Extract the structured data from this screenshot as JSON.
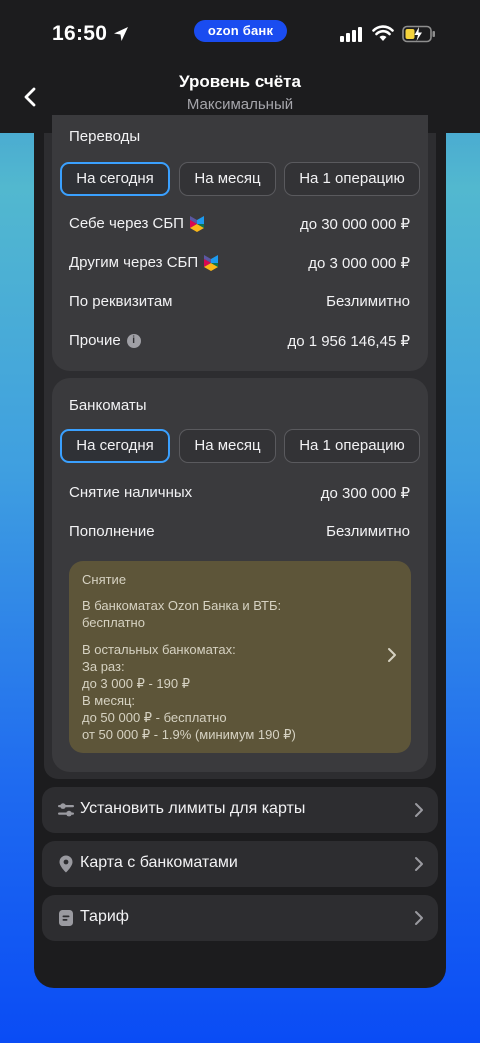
{
  "status_bar": {
    "time": "16:50",
    "app_pill": "ozon банк"
  },
  "nav": {
    "title": "Уровень счёта",
    "subtitle": "Максимальный"
  },
  "transfers": {
    "title": "Переводы",
    "tabs": [
      "На сегодня",
      "На месяц",
      "На 1 операцию"
    ],
    "active_tab": 0,
    "rows": [
      {
        "label": "Себе через СБП",
        "value": "до 30 000 000 ₽",
        "icon": "sbp-icon"
      },
      {
        "label": "Другим через СБП",
        "value": "до 3 000 000 ₽",
        "icon": "sbp-icon"
      },
      {
        "label": "По реквизитам",
        "value": "Безлимитно"
      },
      {
        "label": "Прочие",
        "value": "до 1 956 146,45 ₽",
        "icon": "info-icon"
      }
    ]
  },
  "atms": {
    "title": "Банкоматы",
    "tabs": [
      "На сегодня",
      "На месяц",
      "На 1 операцию"
    ],
    "active_tab": 0,
    "rows": [
      {
        "label": "Снятие наличных",
        "value": "до 300 000 ₽"
      },
      {
        "label": "Пополнение",
        "value": "Безлимитно"
      }
    ],
    "note": {
      "heading": "Снятие",
      "line1": "В банкоматах Ozon Банка и ВТБ:",
      "line2": "бесплатно",
      "line3": "В остальных банкоматах:",
      "line4": "За раз:",
      "line5": "до 3 000 ₽ - 190 ₽",
      "line6": "В месяц:",
      "line7": "до 50 000 ₽ - бесплатно",
      "line8": "от 50 000 ₽ - 1.9% (минимум 190 ₽)"
    }
  },
  "menu": [
    {
      "label": "Установить лимиты для карты",
      "icon": "sliders-icon"
    },
    {
      "label": "Карта с банкоматами",
      "icon": "map-pin-icon"
    },
    {
      "label": "Тариф",
      "icon": "document-icon"
    }
  ],
  "colors": {
    "accent": "#3aa0ff",
    "brand_pill": "#1a4cf0",
    "note_bg": "#5d5539"
  }
}
